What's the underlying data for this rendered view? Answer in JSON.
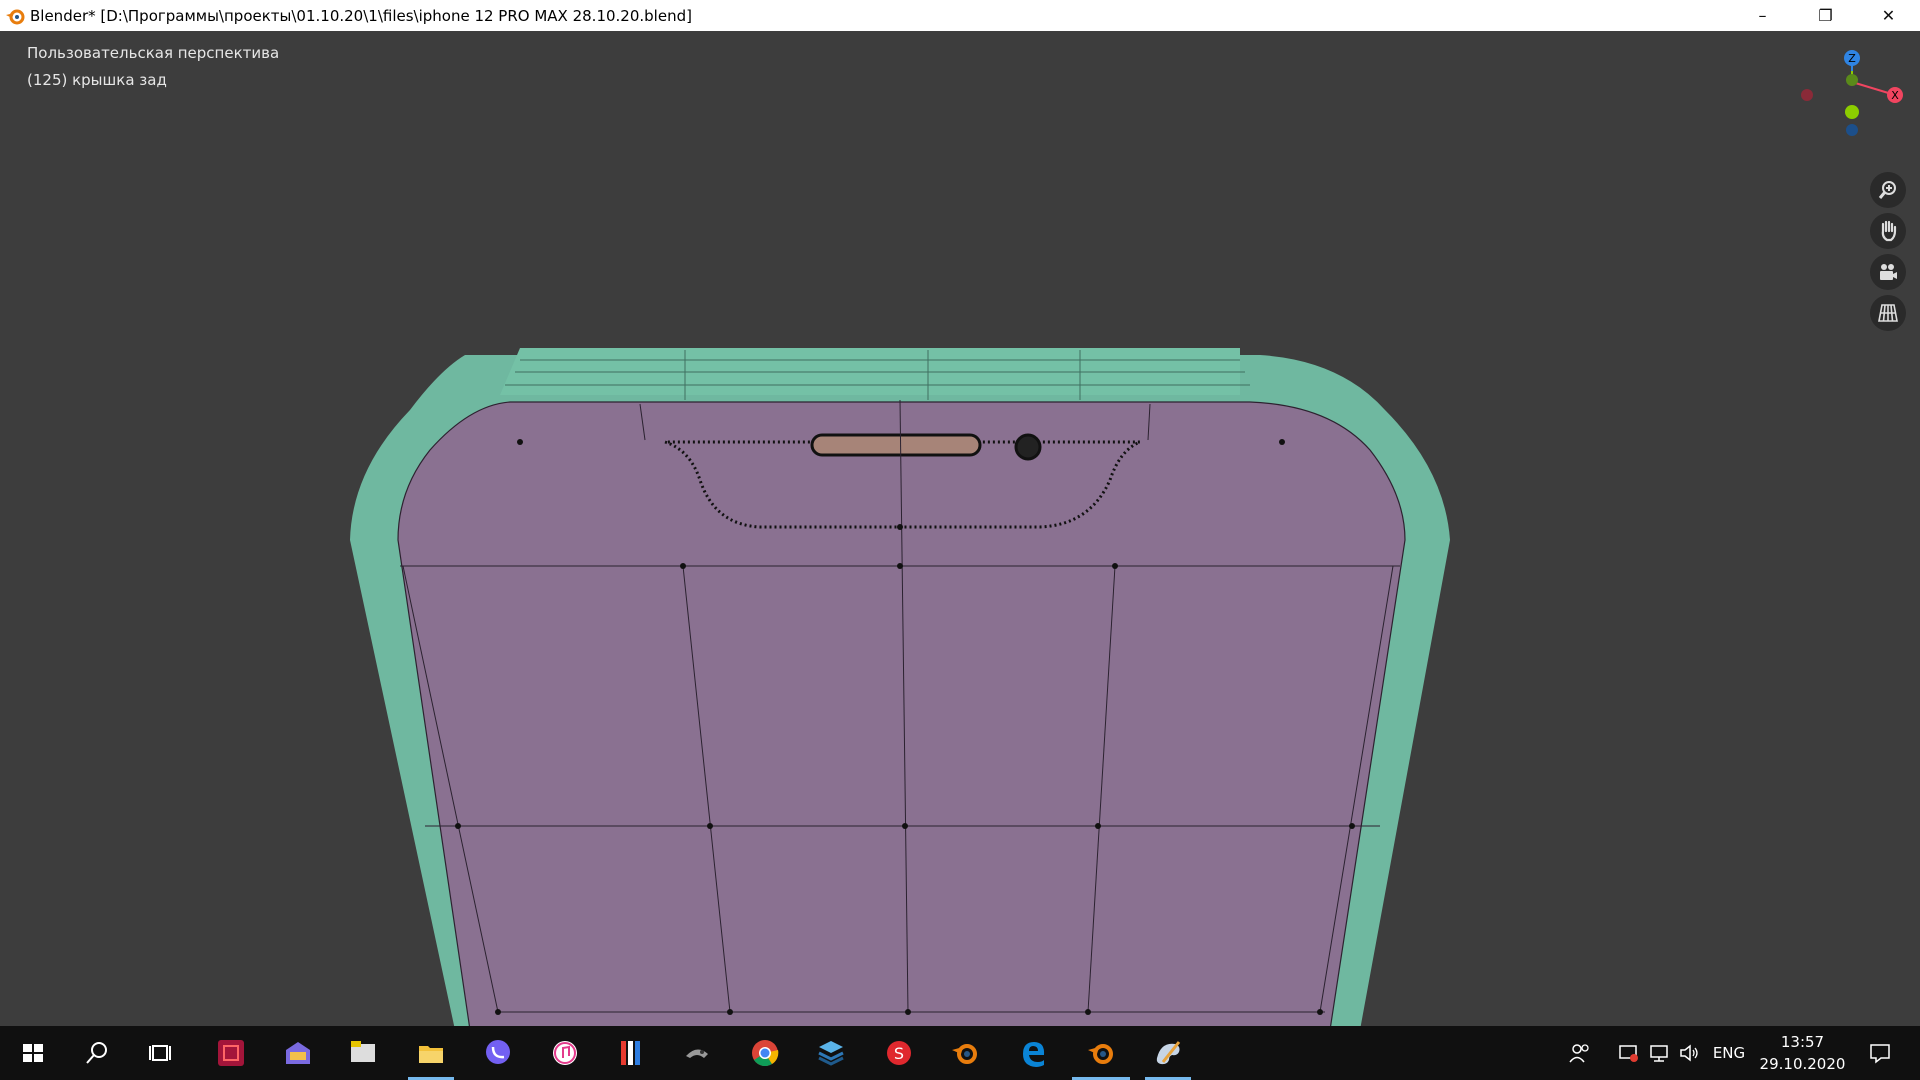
{
  "window": {
    "title": "Blender* [D:\\Программы\\проекты\\01.10.20\\1\\files\\iphone 12 PRO MAX 28.10.20.blend]",
    "minimize": "–",
    "maximize": "❐",
    "close": "✕"
  },
  "viewport": {
    "view_name": "Пользовательская перспектива",
    "object_name": "(125) крышка зад",
    "mesh_face_color": "#8a7191",
    "mesh_rim_color": "#6fb8a0",
    "background": "#3d3d3d"
  },
  "gizmo": {
    "axes": [
      "Z",
      "X"
    ],
    "colors": {
      "x": "#f14560",
      "y": "#8ccd00",
      "z": "#2f84e3"
    }
  },
  "nav_buttons": [
    "zoom-icon",
    "pan-hand-icon",
    "camera-icon",
    "grid-view-icon"
  ],
  "taskbar": {
    "apps": [
      "start-icon",
      "search-icon",
      "task-view-icon",
      "app-icon-1",
      "app-icon-2",
      "app-icon-3",
      "file-explorer-icon",
      "viber-icon",
      "itunes-icon",
      "app-icon-4",
      "app-icon-5",
      "chrome-icon",
      "app-icon-6",
      "app-icon-7",
      "blender-icon",
      "edge-icon",
      "blender-icon",
      "paint-icon"
    ],
    "language": "ENG",
    "time": "13:57",
    "date": "29.10.2020"
  }
}
